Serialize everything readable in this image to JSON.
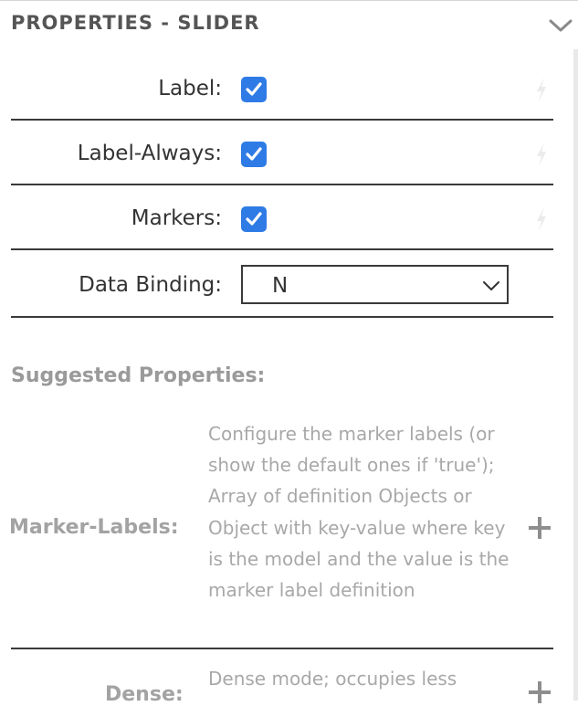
{
  "header": {
    "title": "PROPERTIES - SLIDER",
    "collapse_icon": "chevron-down-icon"
  },
  "properties": [
    {
      "label": "Label:",
      "type": "checkbox",
      "checked": true,
      "binding_icon": "bolt-icon"
    },
    {
      "label": "Label-Always:",
      "type": "checkbox",
      "checked": true,
      "binding_icon": "bolt-icon"
    },
    {
      "label": "Markers:",
      "type": "checkbox",
      "checked": true,
      "binding_icon": "bolt-icon"
    },
    {
      "label": "Data Binding:",
      "type": "select",
      "value": "N"
    }
  ],
  "suggested": {
    "title": "Suggested Properties:",
    "items": [
      {
        "label": "Marker-Labels:",
        "description": "Configure the marker labels (or show the default ones if 'true'); Array of definition Objects or Object with key-value where key is the model and the value is the marker label definition",
        "action_icon": "plus-icon"
      },
      {
        "label": "Dense:",
        "description": "Dense mode; occupies less",
        "action_icon": "plus-icon"
      }
    ]
  },
  "colors": {
    "checkbox": "#2e7be6",
    "muted_text": "#a8a8a8",
    "divider": "#3a3a3a"
  }
}
